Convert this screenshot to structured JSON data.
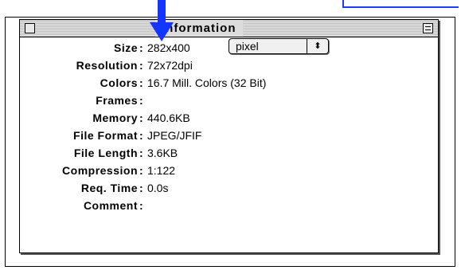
{
  "window": {
    "title": "Information"
  },
  "rows": [
    {
      "label": "Size",
      "value": "282x400"
    },
    {
      "label": "Resolution",
      "value": "72x72dpi"
    },
    {
      "label": "Colors",
      "value": "16.7 Mill. Colors (32 Bit)"
    },
    {
      "label": "Frames",
      "value": ""
    },
    {
      "label": "Memory",
      "value": "440.6KB"
    },
    {
      "label": "File Format",
      "value": "JPEG/JFIF"
    },
    {
      "label": "File Length",
      "value": "3.6KB"
    },
    {
      "label": "Compression",
      "value": "1:122"
    },
    {
      "label": "Req. Time",
      "value": "0.0s"
    },
    {
      "label": "Comment",
      "value": ""
    }
  ],
  "unit_select": {
    "value": "pixel",
    "arrows": "⬍"
  },
  "colors": {
    "arrow": "#1236ff"
  }
}
